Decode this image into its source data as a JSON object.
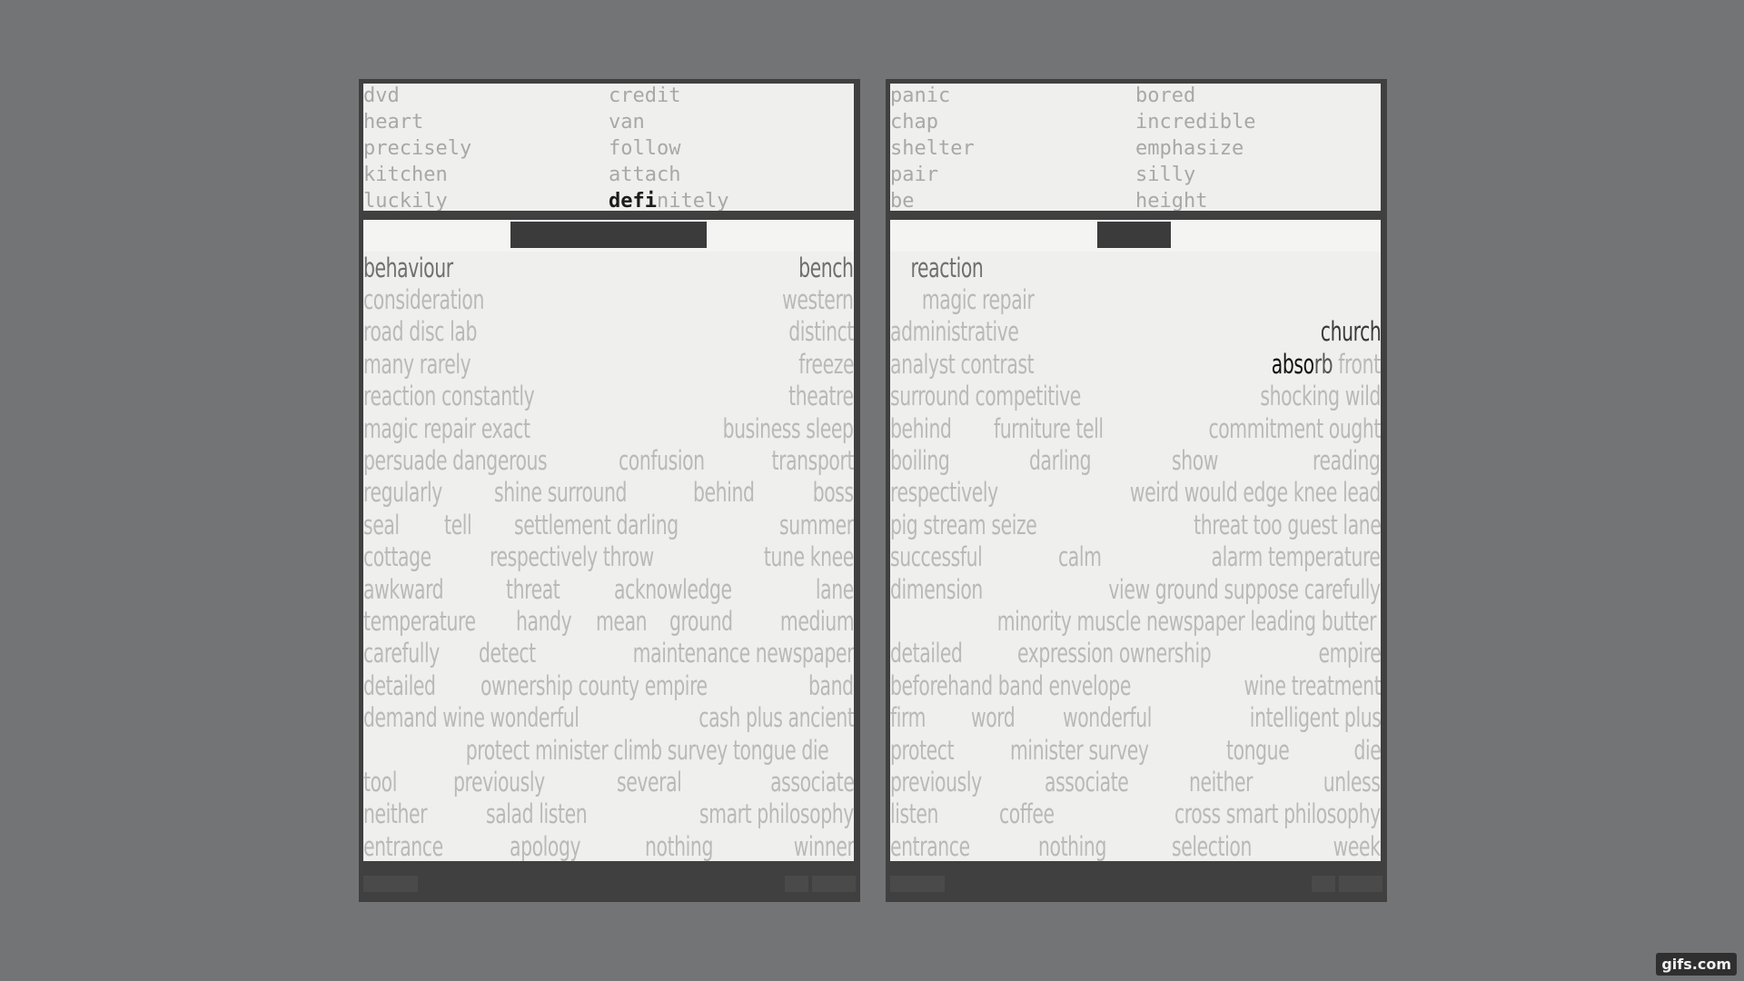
{
  "left": {
    "wordbank": {
      "col0": [
        "dvd",
        "heart",
        "precisely",
        "kitchen",
        "luckily"
      ],
      "col1": [
        "credit",
        "van",
        "follow",
        "attach"
      ],
      "typed_word": {
        "typed": "defi",
        "rest": "nitely"
      }
    },
    "rows": [
      {
        "cls": "first",
        "words": [
          "behaviour",
          "bench"
        ]
      },
      {
        "words": [
          "consideration",
          "western"
        ]
      },
      {
        "words": [
          "road disc lab",
          "distinct"
        ]
      },
      {
        "words": [
          "many  rarely",
          "freeze"
        ]
      },
      {
        "words": [
          "reaction constantly",
          "theatre"
        ]
      },
      {
        "words": [
          "magic repair exact",
          "business sleep"
        ]
      },
      {
        "words": [
          "persuade dangerous",
          "confusion",
          "transport"
        ]
      },
      {
        "words": [
          "regularly",
          "shine surround",
          "behind",
          "boss"
        ]
      },
      {
        "words": [
          "seal",
          "tell",
          "settlement darling",
          "summer"
        ]
      },
      {
        "words": [
          "cottage",
          "respectively throw",
          "tune knee"
        ]
      },
      {
        "words": [
          "awkward",
          "threat",
          "acknowledge",
          "lane"
        ]
      },
      {
        "words": [
          "temperature",
          "handy",
          "mean",
          "ground",
          "medium"
        ]
      },
      {
        "words": [
          "carefully",
          "detect",
          "maintenance newspaper"
        ]
      },
      {
        "words": [
          "detailed",
          "ownership county empire",
          "band"
        ]
      },
      {
        "words": [
          "demand wine wonderful",
          "cash plus ancient"
        ]
      },
      {
        "words": [
          "protect minister climb survey tongue die"
        ]
      },
      {
        "words": [
          "tool",
          "previously",
          "several",
          "associate"
        ]
      },
      {
        "words": [
          "neither",
          "salad listen",
          "smart philosophy"
        ]
      },
      {
        "words": [
          "entrance",
          "apology",
          "nothing",
          "winner"
        ]
      }
    ]
  },
  "right": {
    "wordbank": {
      "col0": [
        "panic",
        "chap",
        "shelter",
        "pair",
        "be"
      ],
      "col1": [
        "bored",
        "incredible",
        "emphasize",
        "silly",
        "height"
      ]
    },
    "rows": [
      {
        "cls": "first single",
        "words": [
          "reaction"
        ]
      },
      {
        "cls": "single",
        "words": [
          "magic repair"
        ]
      },
      {
        "words": [
          "administrative"
        ],
        "active_right": "church"
      },
      {
        "words": [
          "analyst contrast"
        ],
        "active_typed": {
          "typed": "abso",
          "rest": "rb",
          "after": " front"
        }
      },
      {
        "words": [
          "surround competitive",
          "shocking wild"
        ]
      },
      {
        "words": [
          "behind",
          "furniture tell",
          "commitment ought"
        ]
      },
      {
        "words": [
          "boiling",
          "darling",
          "show",
          "reading"
        ]
      },
      {
        "words": [
          "respectively",
          "weird would edge knee lead"
        ]
      },
      {
        "words": [
          "pig stream seize",
          "threat too guest lane"
        ]
      },
      {
        "words": [
          "successful",
          "calm",
          "alarm temperature"
        ]
      },
      {
        "words": [
          "dimension",
          "view ground suppose carefully"
        ]
      },
      {
        "words": [
          "minority muscle newspaper leading butter"
        ]
      },
      {
        "words": [
          "detailed",
          "expression ownership",
          "empire"
        ]
      },
      {
        "words": [
          "beforehand band envelope",
          "wine treatment"
        ]
      },
      {
        "words": [
          "firm",
          "word",
          "wonderful",
          "intelligent plus"
        ]
      },
      {
        "words": [
          "protect",
          "minister survey",
          "tongue",
          "die"
        ]
      },
      {
        "words": [
          "previously",
          "associate",
          "neither",
          "unless"
        ]
      },
      {
        "words": [
          "listen",
          "coffee",
          "cross smart philosophy"
        ]
      },
      {
        "words": [
          "entrance",
          "nothing",
          "selection",
          "week"
        ]
      }
    ]
  },
  "watermark": "gifs.com"
}
